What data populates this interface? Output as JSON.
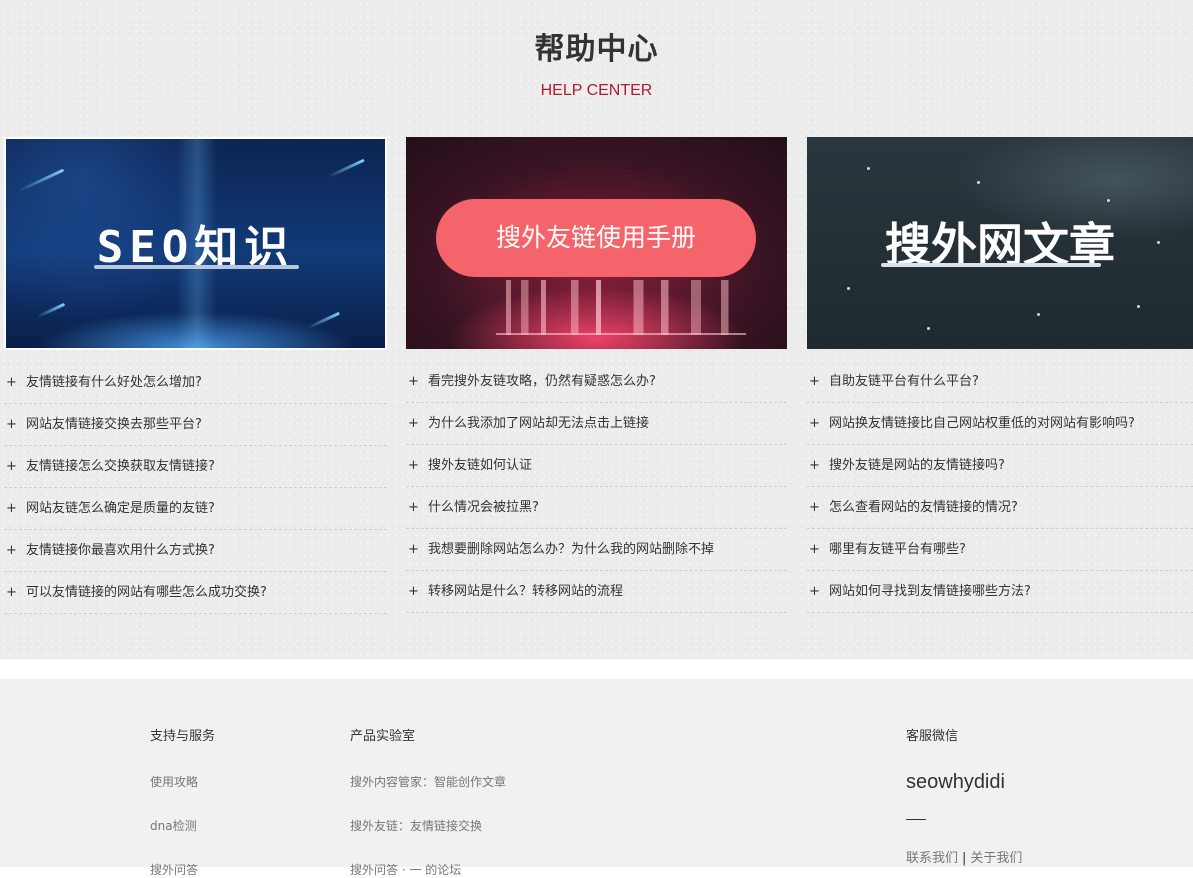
{
  "help": {
    "title": "帮助中心",
    "subtitle": "HELP CENTER",
    "columns": [
      {
        "banner_text": "SEO知识",
        "items": [
          "友情链接有什么好处怎么增加?",
          "网站友情链接交换去那些平台?",
          "友情链接怎么交换获取友情链接?",
          "网站友链怎么确定是质量的友链?",
          "友情链接你最喜欢用什么方式换?",
          "可以友情链接的网站有哪些怎么成功交换?"
        ]
      },
      {
        "banner_text": "搜外友链使用手册",
        "items": [
          "看完搜外友链攻略，仍然有疑惑怎么办?",
          "为什么我添加了网站却无法点击上链接",
          "搜外友链如何认证",
          "什么情况会被拉黑?",
          "我想要删除网站怎么办？为什么我的网站删除不掉",
          "转移网站是什么？转移网站的流程"
        ]
      },
      {
        "banner_text": "搜外网文章",
        "items": [
          "自助友链平台有什么平台?",
          "网站换友情链接比自己网站权重低的对网站有影响吗?",
          "搜外友链是网站的友情链接吗?",
          "怎么查看网站的友情链接的情况?",
          "哪里有友链平台有哪些?",
          "网站如何寻找到友情链接哪些方法?"
        ]
      }
    ],
    "plus_symbol": "+"
  },
  "footer": {
    "support": {
      "title": "支持与服务",
      "links": [
        "使用攻略",
        "dna检测",
        "搜外问答"
      ]
    },
    "lab": {
      "title": "产品实验室",
      "links": [
        "搜外内容管家：智能创作文章",
        "搜外友链：友情链接交换",
        "搜外问答 · 一 的论坛"
      ]
    },
    "service": {
      "title": "客服微信",
      "wechat_id": "seowhydidi",
      "contact_label": "联系我们",
      "separator": "|",
      "about_label": "关于我们"
    }
  }
}
